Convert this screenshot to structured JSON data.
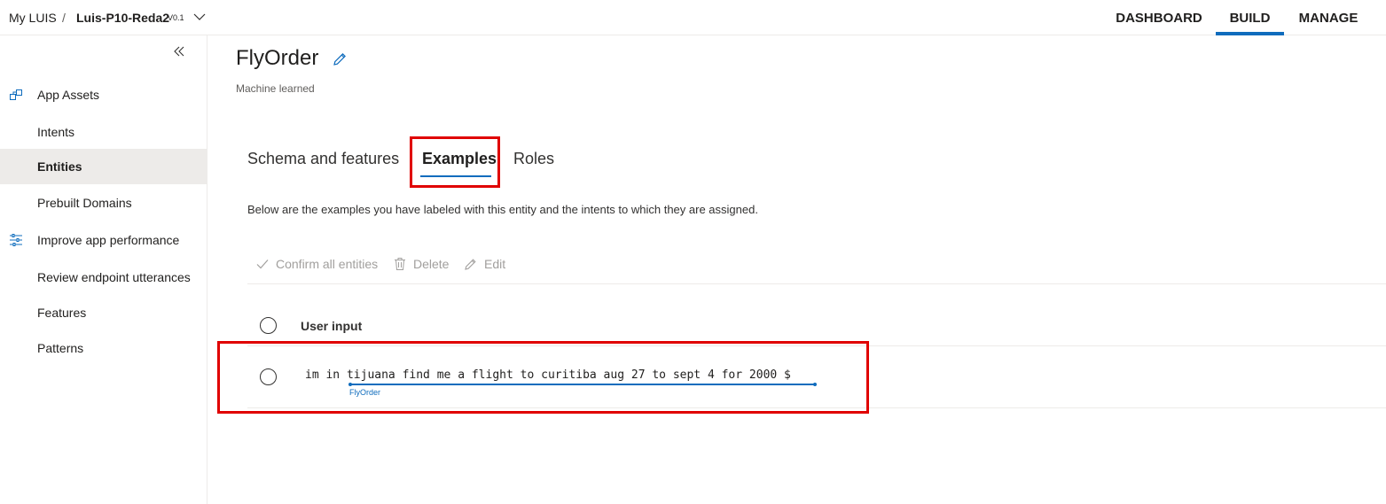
{
  "header": {
    "root": "My LUIS",
    "separator": "/",
    "app_name": "Luis-P10-Reda2",
    "version": "V0.1",
    "nav": {
      "dashboard": "DASHBOARD",
      "build": "BUILD",
      "manage": "MANAGE"
    },
    "active_nav": "BUILD"
  },
  "sidebar": {
    "collapse_icon": "double-chevron-left-icon",
    "items": [
      {
        "label": "App Assets",
        "icon": "app-assets-icon"
      },
      {
        "label": "Intents"
      },
      {
        "label": "Entities",
        "active": true
      },
      {
        "label": "Prebuilt Domains"
      },
      {
        "label": "Improve app performance",
        "icon": "sliders-icon"
      },
      {
        "label": "Review endpoint utterances"
      },
      {
        "label": "Features"
      },
      {
        "label": "Patterns"
      }
    ]
  },
  "entity": {
    "name": "FlyOrder",
    "type": "Machine learned",
    "edit_icon": "pencil-icon"
  },
  "tabs": [
    {
      "label": "Schema and features"
    },
    {
      "label": "Examples",
      "active": true
    },
    {
      "label": "Roles"
    }
  ],
  "description": "Below are the examples you have labeled with this entity and the intents to which they are assigned.",
  "commands": {
    "confirm": "Confirm all entities",
    "delete": "Delete",
    "edit": "Edit"
  },
  "table": {
    "column_header": "User input",
    "rows": [
      {
        "prefix": "im in ",
        "labeled_text": "tijuana find me a flight to curitiba aug 27 to sept 4 for 2000 $",
        "entity_label": "FlyOrder"
      }
    ]
  },
  "colors": {
    "accent": "#0f6cbd",
    "highlight_box": "#e00000",
    "active_bg": "#edebe9"
  }
}
